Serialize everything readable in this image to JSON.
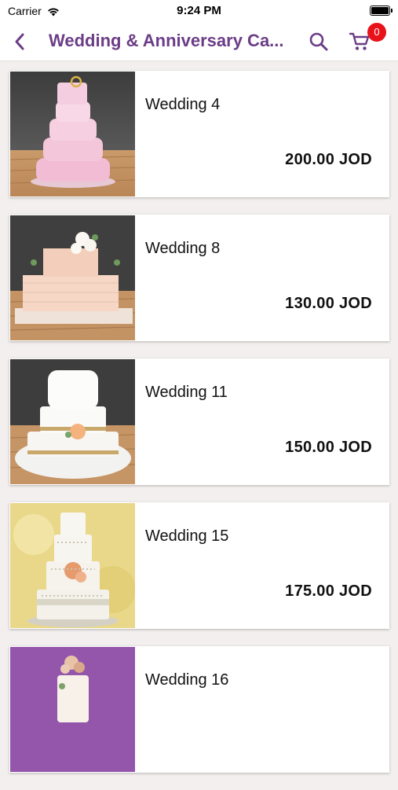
{
  "status": {
    "carrier": "Carrier",
    "time": "9:24 PM"
  },
  "nav": {
    "title": "Wedding & Anniversary Ca...",
    "cart_count": "0",
    "accent": "#6b3d87",
    "badge_color": "#e8121b"
  },
  "products": [
    {
      "name": "Wedding 4",
      "price": "200.00 JOD"
    },
    {
      "name": "Wedding 8",
      "price": "130.00 JOD"
    },
    {
      "name": "Wedding 11",
      "price": "150.00 JOD"
    },
    {
      "name": "Wedding 15",
      "price": "175.00 JOD"
    },
    {
      "name": "Wedding 16",
      "price": ""
    }
  ],
  "icons": [
    "wifi-icon",
    "battery-icon",
    "back-chevron-icon",
    "search-icon",
    "cart-icon"
  ]
}
